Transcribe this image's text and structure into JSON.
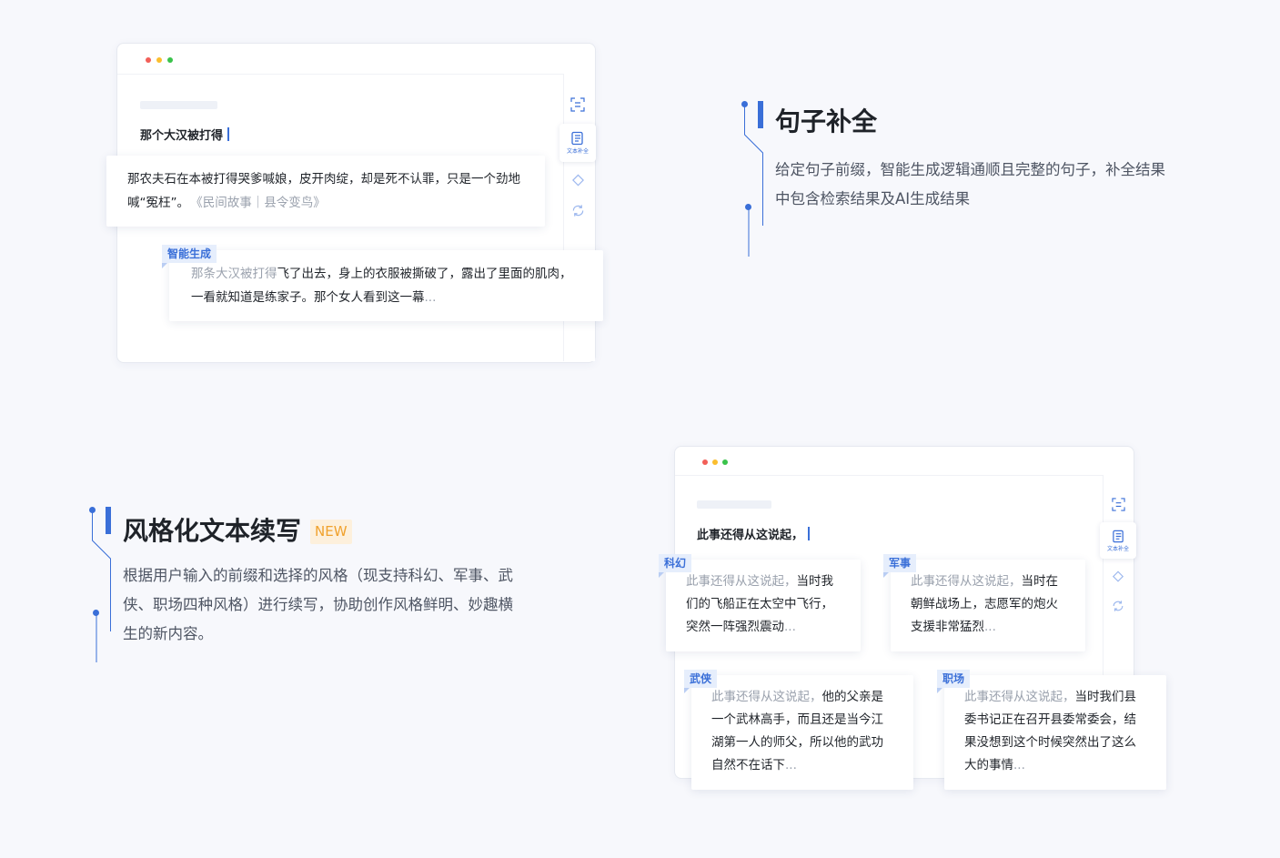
{
  "top_demo": {
    "input_text": "那个大汉被打得",
    "sidebar": {
      "active_label": "文本补全"
    },
    "search_result": {
      "text": "那农夫石在本被打得哭爹喊娘，皮开肉绽，却是死不认罪，只是一个劲地喊“冤枉”。",
      "source": "《民间故事｜县令变鸟》"
    },
    "ai_result": {
      "tag": "智能生成",
      "prefix": "那条大汉被打得",
      "continuation": "飞了出去，身上的衣服被撕破了，露出了里面的肌肉，一看就知道是练家子。那个女人看到这一幕",
      "ellipsis": "..."
    }
  },
  "feature1": {
    "title": "句子补全",
    "description": "给定句子前缀，智能生成逻辑通顺且完整的句子，补全结果中包含检索结果及AI生成结果"
  },
  "feature2": {
    "title": "风格化文本续写",
    "badge": "NEW",
    "description": "根据用户输入的前缀和选择的风格（现支持科幻、军事、武侠、职场四种风格）进行续写，协助创作风格鲜明、妙趣横生的新内容。"
  },
  "bottom_demo": {
    "input_text": "此事还得从这说起，",
    "sidebar": {
      "active_label": "文本补全"
    },
    "cards": [
      {
        "tag": "科幻",
        "prefix": "此事还得从这说起，",
        "text": "当时我们的飞船正在太空中飞行，突然一阵强烈震动",
        "ellipsis": "..."
      },
      {
        "tag": "军事",
        "prefix": "此事还得从这说起，",
        "text": "当时在朝鲜战场上，志愿军的炮火支援非常猛烈",
        "ellipsis": "..."
      },
      {
        "tag": "武侠",
        "prefix": "此事还得从这说起，",
        "text": "他的父亲是一个武林高手，而且还是当今江湖第一人的师父，所以他的武功自然不在话下",
        "ellipsis": "..."
      },
      {
        "tag": "职场",
        "prefix": "此事还得从这说起，",
        "text": "当时我们县委书记正在召开县委常委会，结果没想到这个时候突然出了这么大的事情",
        "ellipsis": "..."
      }
    ]
  },
  "colors": {
    "accent": "#3a6fd8",
    "dot_red": "#f25f58",
    "dot_yellow": "#fbbe2e",
    "dot_green": "#3ac34b",
    "badge_bg": "#fdf0dc",
    "badge_text": "#f0a22e"
  },
  "icons": [
    "scan-text-icon",
    "document-icon",
    "tag-icon",
    "refresh-icon"
  ]
}
